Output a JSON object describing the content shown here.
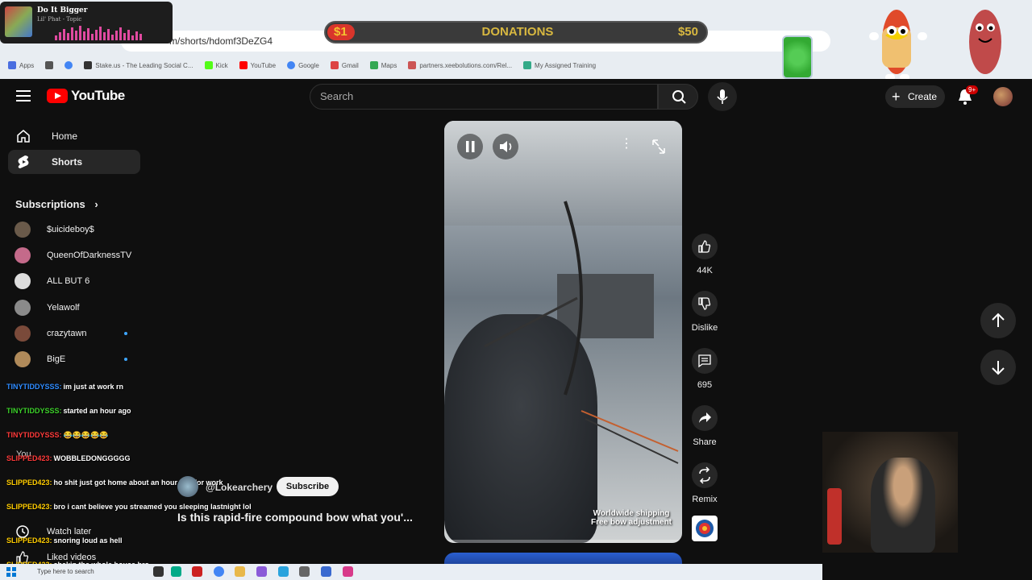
{
  "music": {
    "title": "Do It Bigger",
    "artist": "Lil' Phat - Topic"
  },
  "donations": {
    "min": "$1",
    "label": "DONATIONS",
    "max": "$50"
  },
  "browser": {
    "url": "m/shorts/hdomf3DeZG4",
    "bookmarks": [
      "Apps",
      "Stake.us - The Leading Social C...",
      "Kick",
      "YouTube",
      "Google",
      "Gmail",
      "Maps",
      "partners.xeebolutions.com/Rel...",
      "My Assigned Training"
    ]
  },
  "header": {
    "logo": "YouTube",
    "search_placeholder": "Search",
    "create": "Create",
    "notifications": "9+"
  },
  "sidebar": {
    "nav": [
      {
        "label": "Home",
        "icon": "home-icon"
      },
      {
        "label": "Shorts",
        "icon": "shorts-icon"
      }
    ],
    "subscriptions_title": "Subscriptions",
    "subscriptions": [
      {
        "name": "$uicideboy$",
        "color": "#6a5a4a",
        "dot": false
      },
      {
        "name": "QueenOfDarknessTV",
        "color": "#c46a8a",
        "dot": false
      },
      {
        "name": "ALL BUT 6",
        "color": "#dddddd",
        "dot": false
      },
      {
        "name": "Yelawolf",
        "color": "#8a8a8a",
        "dot": false
      },
      {
        "name": "crazytawn",
        "color": "#7a4a3a",
        "dot": true
      },
      {
        "name": "BigE",
        "color": "#b08a5a",
        "dot": true
      }
    ],
    "you_label": "You",
    "bottom": [
      "Watch later",
      "Liked videos"
    ]
  },
  "chat": [
    {
      "user": "TINYTIDDYSSS:",
      "msg": "im just at work rn",
      "color": "#2e8bff"
    },
    {
      "user": "TINYTIDDYSSS:",
      "msg": "started an hour ago",
      "color": "#3cd02a"
    },
    {
      "user": "TINYTIDDYSSS:",
      "msg": "😂😂😂😂😂",
      "color": "#ff3a3a"
    },
    {
      "user": "SLIPPED423:",
      "msg": "WOBBLEDONGGGGG",
      "color": "#ff3a3a"
    },
    {
      "user": "SLIPPED423:",
      "msg": "ho shit just got home about an hour ago for work",
      "color": "#ffcc00"
    },
    {
      "user": "SLIPPED423:",
      "msg": "bro i cant believe you streamed you sleeping lastnight lol",
      "color": "#ffcc00"
    },
    {
      "user": "SLIPPED423:",
      "msg": "snoring loud as hell",
      "color": "#ffcc00"
    },
    {
      "user": "SLIPPED423:",
      "msg": "shakin the whole house bro",
      "color": "#ffcc00"
    }
  ],
  "video": {
    "channel": "@Lokearchery",
    "subscribe": "Subscribe",
    "title": "Is this rapid-fire compound bow what you'...",
    "overlay_line1": "Worldwide shipping",
    "overlay_line2": "Free bow adjustment",
    "progress": 0.0
  },
  "actions": [
    {
      "label": "44K",
      "icon": "like-icon"
    },
    {
      "label": "Dislike",
      "icon": "dislike-icon"
    },
    {
      "label": "695",
      "icon": "comment-icon"
    },
    {
      "label": "Share",
      "icon": "share-icon"
    },
    {
      "label": "Remix",
      "icon": "remix-icon"
    }
  ],
  "taskbar": {
    "search": "Type here to search"
  }
}
